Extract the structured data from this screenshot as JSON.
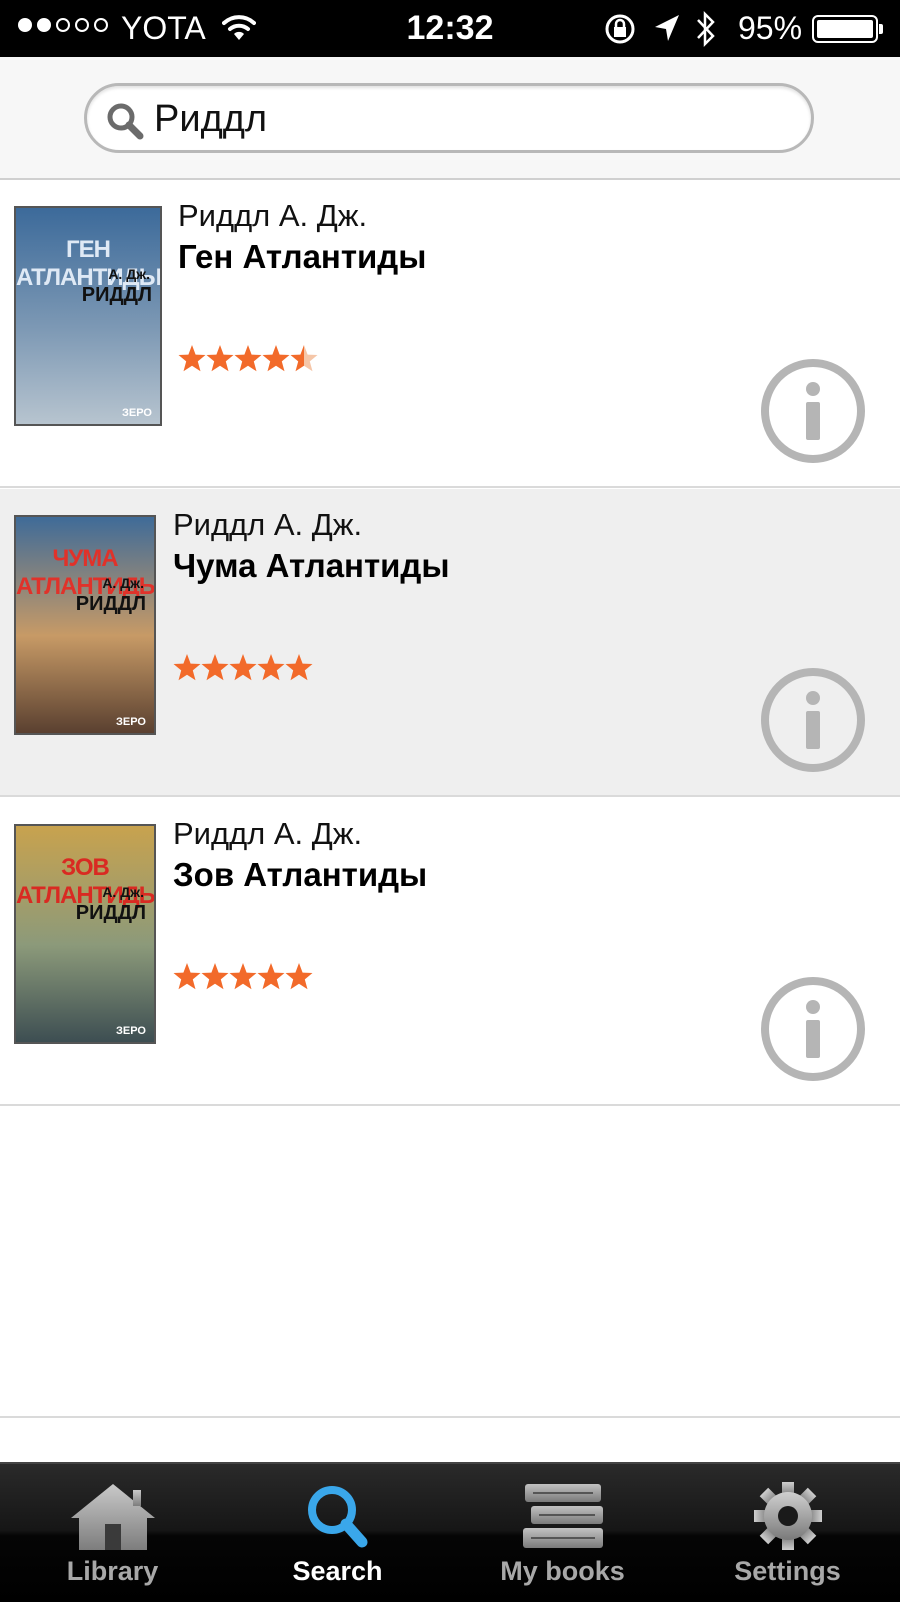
{
  "status": {
    "signal_dots_filled": 2,
    "signal_dots_total": 5,
    "carrier": "YOTA",
    "time": "12:32",
    "battery_pct": "95%"
  },
  "search": {
    "query": "Риддл",
    "icon": "search-icon"
  },
  "results": [
    {
      "author": "Риддл А. Дж.",
      "title": "Ген Атлантиды",
      "rating": 4.5,
      "cover": {
        "title": "ГЕН АТЛАНТИДЫ",
        "author_short": "А. Дж.",
        "author": "РИДДЛ",
        "publisher": "ЗЕРО",
        "title_color": "#dfe9f5",
        "bg": [
          "#3c6a9a",
          "#7c98b4",
          "#b7c4cf"
        ]
      }
    },
    {
      "author": "Риддл А. Дж.",
      "title": "Чума Атлантиды",
      "rating": 5,
      "cover": {
        "title": "ЧУМА АТЛАНТИДЫ",
        "author_short": "А. Дж.",
        "author": "РИДДЛ",
        "publisher": "ЗЕРО",
        "title_color": "#e0322a",
        "bg": [
          "#3f6b98",
          "#c79a66",
          "#5a4030"
        ]
      }
    },
    {
      "author": "Риддл А. Дж.",
      "title": "Зов Атлантиды",
      "rating": 5,
      "cover": {
        "title": "ЗОВ АТЛАНТИДЫ",
        "author_short": "А. Дж.",
        "author": "РИДДЛ",
        "publisher": "ЗЕРО",
        "title_color": "#d92a22",
        "bg": [
          "#c8a24e",
          "#8c9a7a",
          "#3d4e52"
        ]
      }
    }
  ],
  "tabs": [
    {
      "label": "Library",
      "icon": "house-icon",
      "active": false
    },
    {
      "label": "Search",
      "icon": "search-icon",
      "active": true
    },
    {
      "label": "My books",
      "icon": "books-stack-icon",
      "active": false
    },
    {
      "label": "Settings",
      "icon": "gear-icon",
      "active": false
    }
  ],
  "colors": {
    "star": "#f26a2a",
    "star_empty": "#f5c6a8",
    "info_icon": "#b5b5b5",
    "active_tab_icon": "#3aa7ea"
  }
}
